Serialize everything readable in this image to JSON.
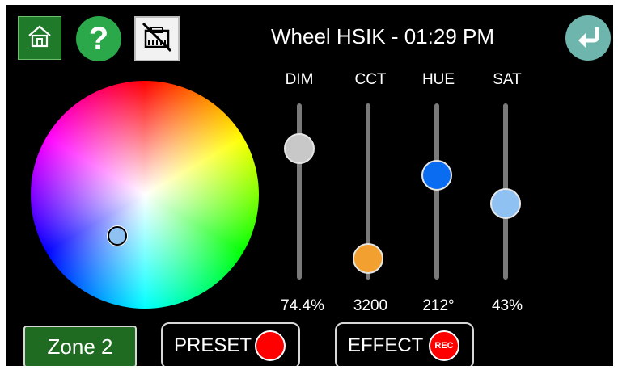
{
  "header": {
    "title": "Wheel HSIK - 01:29 PM",
    "icons": {
      "home": "home-icon",
      "help": "help-icon",
      "network": "network-disconnected-icon",
      "back": "back-arrow-icon"
    },
    "help_glyph": "?"
  },
  "wheel": {
    "selected_color": "#8fc2f2"
  },
  "sliders": [
    {
      "label": "DIM",
      "value": "74.4%",
      "level": 0.744,
      "knob_color": "#c8c8c8"
    },
    {
      "label": "CCT",
      "value": "3200",
      "level": 0.12,
      "knob_color": "#f2a030"
    },
    {
      "label": "HUE",
      "value": "212°",
      "level": 0.59,
      "knob_color": "#0a6cf0"
    },
    {
      "label": "SAT",
      "value": "43%",
      "level": 0.43,
      "knob_color": "#8fc2f2"
    }
  ],
  "footer": {
    "zone_label": "Zone 2",
    "preset_label": "PRESET",
    "effect_label": "EFFECT",
    "rec_label": "REC"
  },
  "colors": {
    "background": "#000000",
    "zone_green": "#1f6b22",
    "back_button": "#6db5ad",
    "record_red": "#ff0000"
  }
}
